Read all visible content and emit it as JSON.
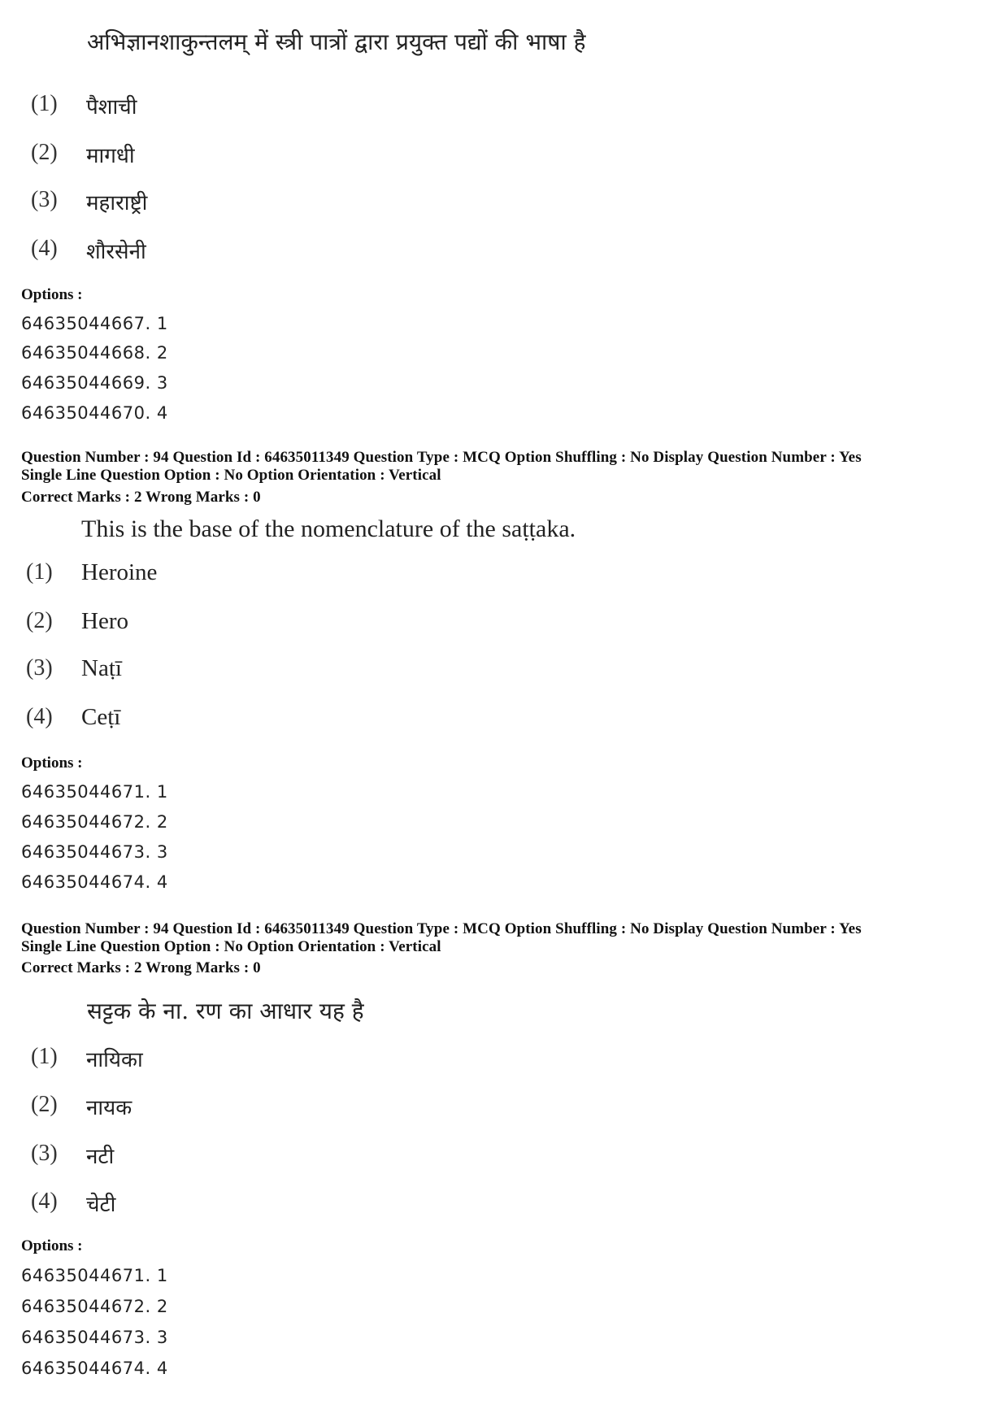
{
  "questions": [
    {
      "header": null,
      "question_text": "अभिज्ञानशाकुन्तलम् में स्त्री पात्रों द्वारा प्रयुक्त पद्यों की भाषा है",
      "choices": [
        {
          "num": "(1)",
          "text": "पैशाची"
        },
        {
          "num": "(2)",
          "text": "मागधी"
        },
        {
          "num": "(3)",
          "text": "महाराष्ट्री"
        },
        {
          "num": "(4)",
          "text": "शौरसेनी"
        }
      ],
      "options_label": "Options :",
      "option_ids": [
        "64635044667. 1",
        "64635044668. 2",
        "64635044669. 3",
        "64635044670. 4"
      ]
    },
    {
      "header": {
        "line1": "Question Number : 94  Question Id : 64635011349  Question Type : MCQ  Option Shuffling : No  Display Question Number : Yes",
        "line2": "Single Line Question Option : No  Option Orientation : Vertical",
        "marks": "Correct Marks : 2  Wrong Marks : 0"
      },
      "question_text": "This is the base of the nomenclature of the saṭṭaka.",
      "choices": [
        {
          "num": "(1)",
          "text": "Heroine"
        },
        {
          "num": "(2)",
          "text": "Hero"
        },
        {
          "num": "(3)",
          "text": "Naṭī"
        },
        {
          "num": "(4)",
          "text": "Ceṭī"
        }
      ],
      "options_label": "Options :",
      "option_ids": [
        "64635044671. 1",
        "64635044672. 2",
        "64635044673. 3",
        "64635044674. 4"
      ]
    },
    {
      "header": {
        "line1": "Question Number : 94  Question Id : 64635011349  Question Type : MCQ  Option Shuffling : No  Display Question Number : Yes",
        "line2": "Single Line Question Option : No  Option Orientation : Vertical",
        "marks": "Correct Marks : 2  Wrong Marks : 0"
      },
      "question_text": "सट्टक के ना. रण का आधार यह है",
      "choices": [
        {
          "num": "(1)",
          "text": "नायिका"
        },
        {
          "num": "(2)",
          "text": "नायक"
        },
        {
          "num": "(3)",
          "text": "नटी"
        },
        {
          "num": "(4)",
          "text": "चेटी"
        }
      ],
      "options_label": "Options :",
      "option_ids": [
        "64635044671. 1",
        "64635044672. 2",
        "64635044673. 3",
        "64635044674. 4"
      ]
    }
  ]
}
